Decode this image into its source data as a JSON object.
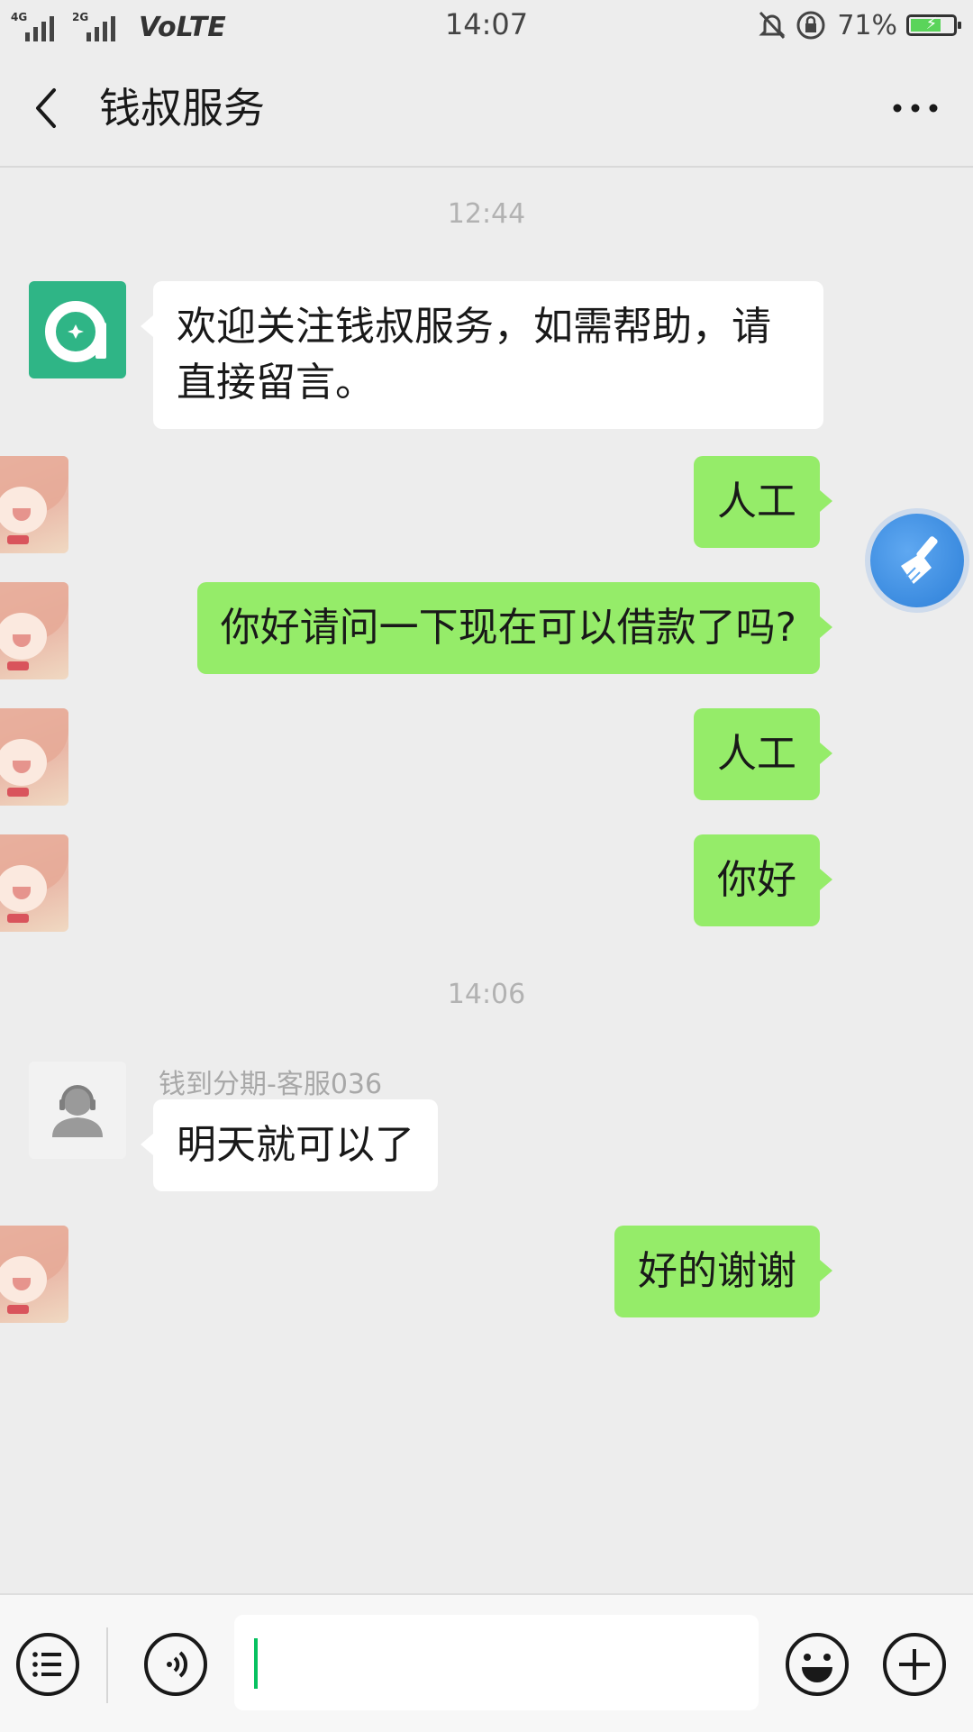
{
  "status_bar": {
    "signal1_tag": "4G",
    "signal2_tag": "2G",
    "volte": "VoLTE",
    "time": "14:07",
    "battery_percent": "71%",
    "battery_level": 0.71
  },
  "header": {
    "title": "钱叔服务",
    "back_icon": "chevron-left-icon",
    "more_icon": "more-horizontal-icon"
  },
  "messages": {
    "time1": "12:44",
    "msg1": "欢迎关注钱叔服务，如需帮助，请直接留言。",
    "msg2": "人工",
    "msg3": "你好请问一下现在可以借款了吗?",
    "msg4": "人工",
    "msg5": "你好",
    "time2": "14:06",
    "agent_name": "钱到分期-客服036",
    "msg6": "明天就可以了",
    "msg7": "好的谢谢"
  },
  "input_bar": {
    "placeholder": "",
    "menu_icon": "menu-list-icon",
    "voice_icon": "voice-icon",
    "emoji_icon": "emoji-icon",
    "plus_icon": "plus-icon"
  },
  "colors": {
    "background": "#ededed",
    "bubble_out": "#95ec69",
    "bubble_in": "#ffffff",
    "brand_avatar": "#2fb586"
  }
}
